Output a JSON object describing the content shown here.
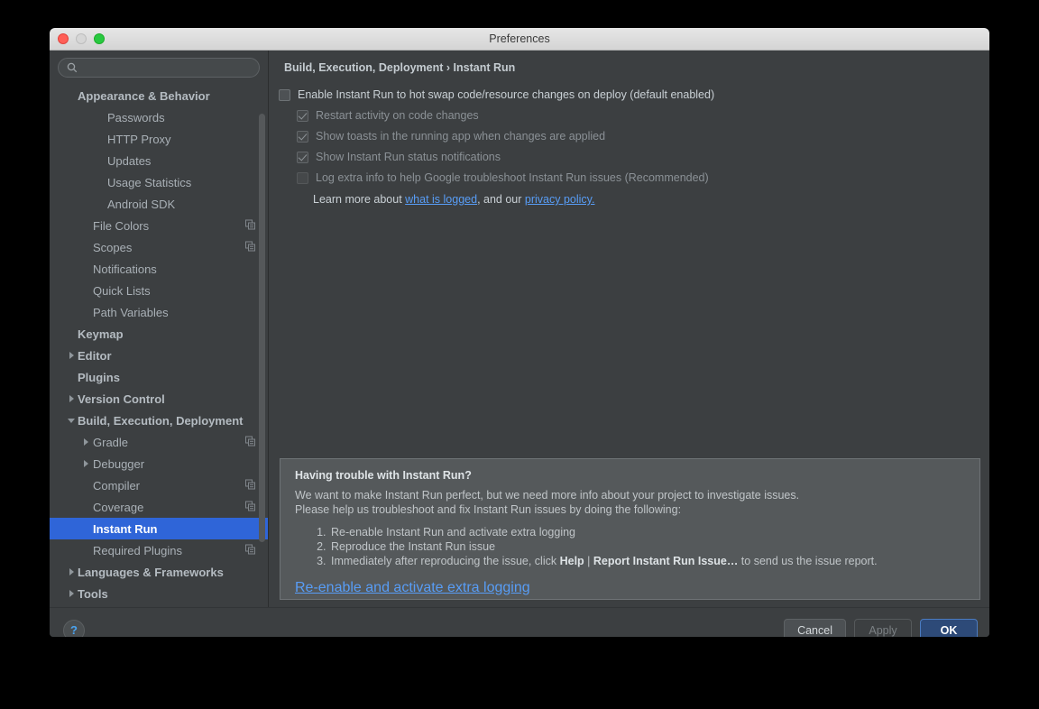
{
  "window": {
    "title": "Preferences",
    "traffic_lights": [
      "close-button",
      "minimize-button",
      "zoom-button"
    ]
  },
  "sidebar": {
    "search": {
      "value": "",
      "placeholder": ""
    },
    "items": [
      {
        "label": "Appearance & Behavior",
        "level": 1,
        "bold": true,
        "arrow": "none",
        "copy": false,
        "selected": false
      },
      {
        "label": "Passwords",
        "level": 3,
        "bold": false,
        "arrow": "none",
        "copy": false,
        "selected": false
      },
      {
        "label": "HTTP Proxy",
        "level": 3,
        "bold": false,
        "arrow": "none",
        "copy": false,
        "selected": false
      },
      {
        "label": "Updates",
        "level": 3,
        "bold": false,
        "arrow": "none",
        "copy": false,
        "selected": false
      },
      {
        "label": "Usage Statistics",
        "level": 3,
        "bold": false,
        "arrow": "none",
        "copy": false,
        "selected": false
      },
      {
        "label": "Android SDK",
        "level": 3,
        "bold": false,
        "arrow": "none",
        "copy": false,
        "selected": false
      },
      {
        "label": "File Colors",
        "level": 2,
        "bold": false,
        "arrow": "none",
        "copy": true,
        "selected": false
      },
      {
        "label": "Scopes",
        "level": 2,
        "bold": false,
        "arrow": "none",
        "copy": true,
        "selected": false
      },
      {
        "label": "Notifications",
        "level": 2,
        "bold": false,
        "arrow": "none",
        "copy": false,
        "selected": false
      },
      {
        "label": "Quick Lists",
        "level": 2,
        "bold": false,
        "arrow": "none",
        "copy": false,
        "selected": false
      },
      {
        "label": "Path Variables",
        "level": 2,
        "bold": false,
        "arrow": "none",
        "copy": false,
        "selected": false
      },
      {
        "label": "Keymap",
        "level": 1,
        "bold": true,
        "arrow": "none",
        "copy": false,
        "selected": false
      },
      {
        "label": "Editor",
        "level": 1,
        "bold": true,
        "arrow": "right",
        "copy": false,
        "selected": false
      },
      {
        "label": "Plugins",
        "level": 1,
        "bold": true,
        "arrow": "none",
        "copy": false,
        "selected": false
      },
      {
        "label": "Version Control",
        "level": 1,
        "bold": true,
        "arrow": "right",
        "copy": false,
        "selected": false
      },
      {
        "label": "Build, Execution, Deployment",
        "level": 1,
        "bold": true,
        "arrow": "down",
        "copy": false,
        "selected": false
      },
      {
        "label": "Gradle",
        "level": 2,
        "bold": false,
        "arrow": "right",
        "copy": true,
        "selected": false
      },
      {
        "label": "Debugger",
        "level": 2,
        "bold": false,
        "arrow": "right",
        "copy": false,
        "selected": false
      },
      {
        "label": "Compiler",
        "level": 2,
        "bold": false,
        "arrow": "none",
        "copy": true,
        "selected": false
      },
      {
        "label": "Coverage",
        "level": 2,
        "bold": false,
        "arrow": "none",
        "copy": true,
        "selected": false
      },
      {
        "label": "Instant Run",
        "level": 2,
        "bold": true,
        "arrow": "none",
        "copy": false,
        "selected": true
      },
      {
        "label": "Required Plugins",
        "level": 2,
        "bold": false,
        "arrow": "none",
        "copy": true,
        "selected": false
      },
      {
        "label": "Languages & Frameworks",
        "level": 1,
        "bold": true,
        "arrow": "right",
        "copy": false,
        "selected": false
      },
      {
        "label": "Tools",
        "level": 1,
        "bold": true,
        "arrow": "right",
        "copy": false,
        "selected": false
      }
    ]
  },
  "main": {
    "breadcrumb": "Build, Execution, Deployment › Instant Run",
    "options": [
      {
        "label": "Enable Instant Run to hot swap code/resource changes on deploy (default enabled)",
        "checked": false,
        "enabled": true,
        "indent": "top"
      },
      {
        "label": "Restart activity on code changes",
        "checked": true,
        "enabled": false,
        "indent": "sub"
      },
      {
        "label": "Show toasts in the running app when changes are applied",
        "checked": true,
        "enabled": false,
        "indent": "sub"
      },
      {
        "label": "Show Instant Run status notifications",
        "checked": true,
        "enabled": false,
        "indent": "sub"
      },
      {
        "label": "Log extra info to help Google troubleshoot Instant Run issues (Recommended)",
        "checked": false,
        "enabled": false,
        "indent": "sub"
      }
    ],
    "learn_more": {
      "prefix": "Learn more about ",
      "link1": "what is logged",
      "middle": ", and our ",
      "link2": "privacy policy.",
      "suffix": ""
    },
    "info_panel": {
      "title": "Having trouble with Instant Run?",
      "line1": "We want to make Instant Run perfect, but we need more info about your project to investigate issues.",
      "line2": "Please help us troubleshoot and fix Instant Run issues by doing the following:",
      "steps": [
        {
          "text": "Re-enable Instant Run and activate extra logging"
        },
        {
          "text": "Reproduce the Instant Run issue"
        }
      ],
      "step3": {
        "prefix": "Immediately after reproducing the issue, click ",
        "bold1": "Help",
        "sep": " | ",
        "bold2": "Report Instant Run Issue…",
        "suffix": " to send us the issue report."
      },
      "link": "Re-enable and activate extra logging"
    }
  },
  "footer": {
    "help_glyph": "?",
    "cancel_label": "Cancel",
    "apply_label": "Apply",
    "ok_label": "OK"
  },
  "colors": {
    "window_bg": "#3c3f41",
    "selection_blue": "#2f65d8",
    "link_blue": "#589df6",
    "primary_button": "#2d4a78",
    "panel_bg": "#55595b"
  }
}
